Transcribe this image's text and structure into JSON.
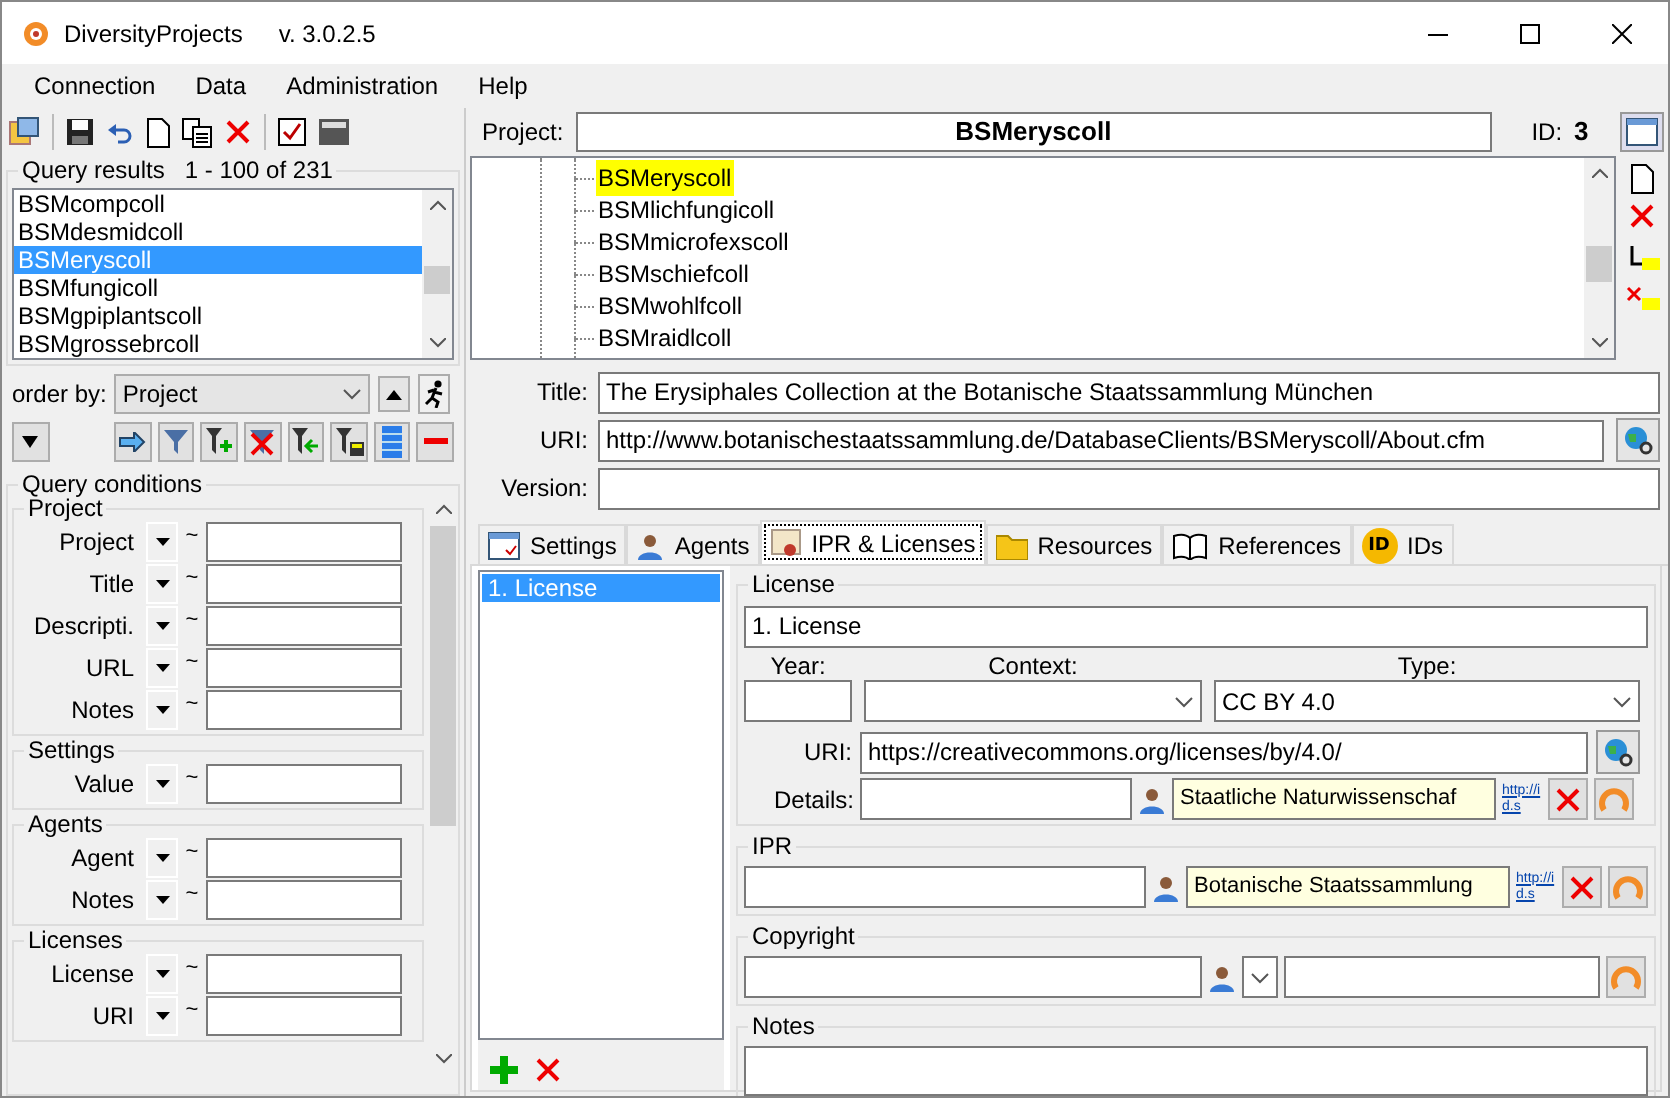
{
  "window": {
    "title": "DiversityProjects",
    "version": "v. 3.0.2.5"
  },
  "menu": [
    "Connection",
    "Data",
    "Administration",
    "Help"
  ],
  "query_results": {
    "label": "Query results",
    "count": "1 - 100 of 231",
    "items": [
      {
        "label": "BSMcompcoll",
        "selected": false
      },
      {
        "label": "BSMdesmidcoll",
        "selected": false
      },
      {
        "label": "BSMeryscoll",
        "selected": true
      },
      {
        "label": "BSMfungicoll",
        "selected": false
      },
      {
        "label": "BSMgpiplantscoll",
        "selected": false
      },
      {
        "label": "BSMgrossebrcoll",
        "selected": false
      }
    ]
  },
  "order_by": {
    "label": "order by:",
    "value": "Project"
  },
  "query_conditions": {
    "label": "Query conditions",
    "groups": [
      {
        "label": "Project",
        "fields": [
          {
            "label": "Project",
            "operator": "~"
          },
          {
            "label": "Title",
            "operator": "~"
          },
          {
            "label": "Descripti.",
            "operator": "~"
          },
          {
            "label": "URL",
            "operator": "~"
          },
          {
            "label": "Notes",
            "operator": "~"
          }
        ]
      },
      {
        "label": "Settings",
        "fields": [
          {
            "label": "Value",
            "operator": "~"
          }
        ]
      },
      {
        "label": "Agents",
        "fields": [
          {
            "label": "Agent",
            "operator": "~"
          },
          {
            "label": "Notes",
            "operator": "~"
          }
        ]
      },
      {
        "label": "Licenses",
        "fields": [
          {
            "label": "License",
            "operator": "~"
          },
          {
            "label": "URI",
            "operator": "~"
          }
        ]
      }
    ]
  },
  "project": {
    "label": "Project:",
    "value": "BSMeryscoll",
    "id_label": "ID:",
    "id_value": "3"
  },
  "tree": {
    "items": [
      {
        "label": "BSMeryscoll",
        "selected": true
      },
      {
        "label": "BSMlichfungicoll",
        "selected": false
      },
      {
        "label": "BSMmicrofexscoll",
        "selected": false
      },
      {
        "label": "BSMschiefcoll",
        "selected": false
      },
      {
        "label": "BSMwohlfcoll",
        "selected": false
      },
      {
        "label": "BSMraidlcoll",
        "selected": false
      }
    ]
  },
  "details": [
    {
      "label": "Title:",
      "value": "The Erysiphales Collection at the Botanische Staatssammlung München"
    },
    {
      "label": "URI:",
      "value": "http://www.botanischestaatssammlung.de/DatabaseClients/BSMeryscoll/About.cfm"
    },
    {
      "label": "Version:"
    }
  ],
  "tabs": [
    {
      "label": "Settings",
      "selected": false
    },
    {
      "label": "Agents",
      "selected": false
    },
    {
      "label": "IPR & Licenses",
      "selected": true
    },
    {
      "label": "Resources",
      "selected": false
    },
    {
      "label": "References",
      "selected": false
    },
    {
      "label": "IDs",
      "selected": false,
      "badge": "ID"
    }
  ],
  "licenses": [
    {
      "label": "1. License",
      "selected": true
    }
  ],
  "license": {
    "label": "License",
    "name": "1. License",
    "year_label": "Year:",
    "context_label": "Context:",
    "type_label": "Type:",
    "type_value": "CC BY 4.0",
    "uri_label": "URI:",
    "uri_value": "https://creativecommons.org/licenses/by/4.0/",
    "details_label": "Details:",
    "agent": "Staatliche Naturwissenschaf",
    "link": "http://id.s"
  },
  "ipr": {
    "label": "IPR",
    "agent": "Botanische Staatssammlung",
    "link": "http://id.s"
  },
  "copyright": {
    "label": "Copyright"
  },
  "notes": {
    "label": "Notes"
  }
}
